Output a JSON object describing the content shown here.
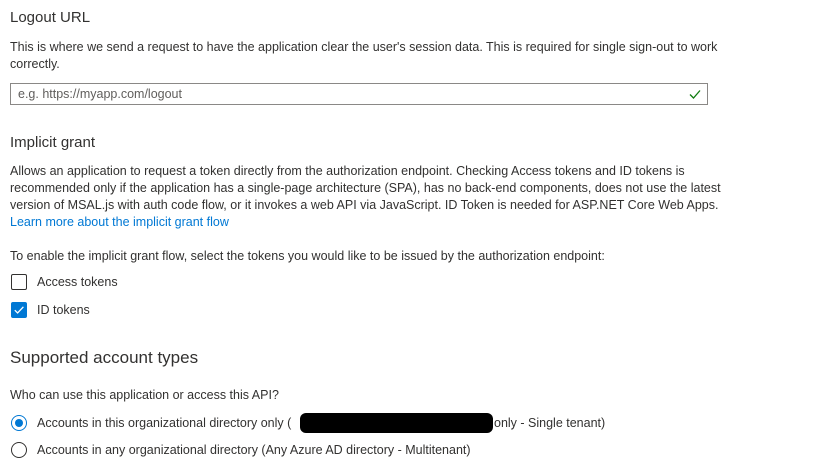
{
  "logout": {
    "heading": "Logout URL",
    "description": "This is where we send a request to have the application clear the user's session data. This is required for single sign-out to work correctly.",
    "input_value": "",
    "input_placeholder": "e.g. https://myapp.com/logout"
  },
  "implicit": {
    "heading": "Implicit grant",
    "description": "Allows an application to request a token directly from the authorization endpoint. Checking Access tokens and ID tokens is recommended only if the application has a single-page architecture (SPA), has no back-end components, does not use the latest version of MSAL.js with auth code flow, or it invokes a web API via JavaScript. ID Token is needed for ASP.NET Core Web Apps.",
    "learn_more": "Learn more about the implicit grant flow",
    "instruction": "To enable the implicit grant flow, select the tokens you would like to be issued by the authorization endpoint:",
    "options": [
      {
        "label": "Access tokens",
        "checked": false
      },
      {
        "label": "ID tokens",
        "checked": true
      }
    ]
  },
  "account_types": {
    "heading": "Supported account types",
    "question": "Who can use this application or access this API?",
    "options": [
      {
        "label_prefix": "Accounts in this organizational directory only (",
        "label_suffix": "only - Single tenant)",
        "selected": true
      },
      {
        "label": "Accounts in any organizational directory (Any Azure AD directory - Multitenant)",
        "selected": false
      }
    ]
  },
  "colors": {
    "accent": "#0078d4",
    "valid": "#107c10",
    "text": "#323130"
  }
}
